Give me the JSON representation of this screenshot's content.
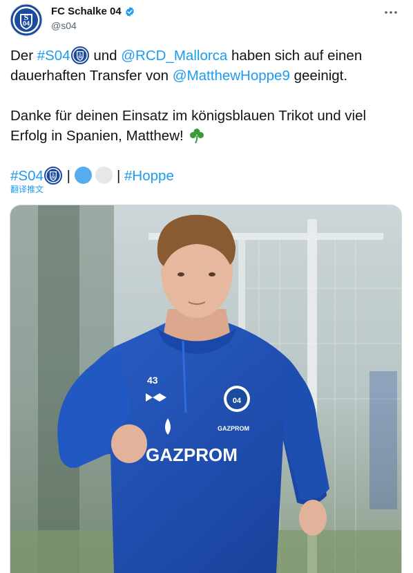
{
  "account": {
    "display_name": "FC Schalke 04",
    "handle": "@s04",
    "avatar_icon": "schalke-crest-icon",
    "logo_text": "04"
  },
  "tweet": {
    "line1_pre": "Der ",
    "hashtag_s04": "#S04",
    "line1_mid": " und ",
    "mention_club": "@RCD_Mallorca",
    "line1_post": " haben sich auf einen dauerhaften Transfer von ",
    "mention_player": "@MatthewHoppe9",
    "line1_end": " geeinigt.",
    "line2": "Danke für deinen Einsatz im königsblauen Trikot und viel Erfolg in Spanien, Matthew! ",
    "shamrock": "☘️",
    "tags_separator": " | ",
    "hashtag_hoppe": "#Hoppe"
  },
  "translate_label": "翻译推文",
  "photo": {
    "jersey_number": "43",
    "sponsor": "GAZPROM",
    "sponsor_small": "GAZPROM",
    "crest_text": "04"
  },
  "colors": {
    "link": "#1d9bf0",
    "jersey": "#1f4fb4",
    "crest_blue": "#1b4b9e"
  }
}
